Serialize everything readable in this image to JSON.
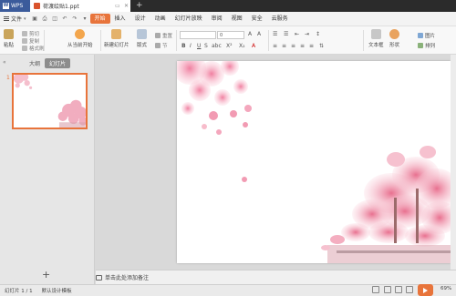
{
  "titlebar": {
    "app_name": "WPS",
    "doc_tab": "荷渡绘贴1.ppt"
  },
  "menubar": {
    "file_label": "文件",
    "items": [
      {
        "label": "开始",
        "active": true
      },
      {
        "label": "插入",
        "active": false
      },
      {
        "label": "设计",
        "active": false
      },
      {
        "label": "动画",
        "active": false
      },
      {
        "label": "幻灯片放映",
        "active": false
      },
      {
        "label": "审阅",
        "active": false
      },
      {
        "label": "视图",
        "active": false
      },
      {
        "label": "安全",
        "active": false
      },
      {
        "label": "云服务",
        "active": false
      }
    ]
  },
  "ribbon": {
    "paste": "粘贴",
    "cut": "剪切",
    "copy": "复制",
    "format_painter": "格式刷",
    "from_start": "从当前开始",
    "new_slide": "新建幻灯片",
    "layout": "版式",
    "reset": "重置",
    "section": "节",
    "font_size": "0",
    "text_box": "文本框",
    "shape": "形状",
    "picture": "图片",
    "arrange": "排列"
  },
  "leftpanel": {
    "tab_outline": "大纲",
    "tab_slides": "幻灯片",
    "thumb_number": "1",
    "add_slide": "+"
  },
  "notes": {
    "placeholder": "单击此处添加备注"
  },
  "statusbar": {
    "slide_info": "幻灯片 1 / 1",
    "template": "默认设计模板",
    "zoom": "69%"
  },
  "colors": {
    "accent": "#e8743b",
    "titlebar": "#2b2b2b",
    "wps_tab": "#3b5b9b"
  }
}
